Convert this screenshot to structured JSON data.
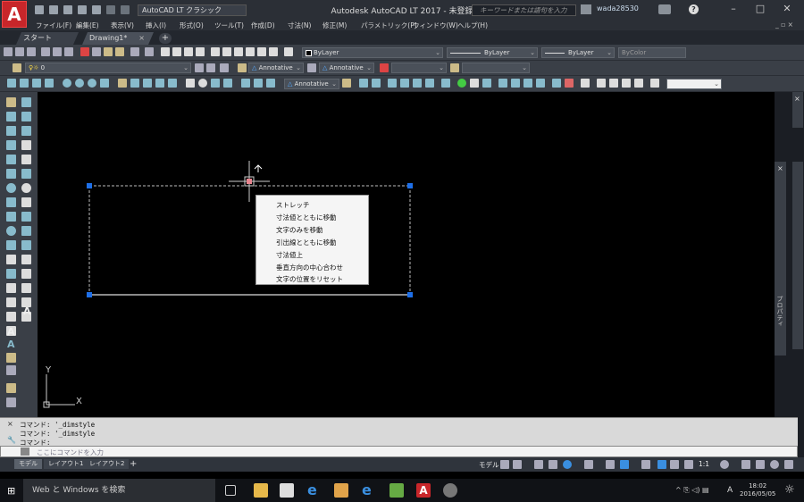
{
  "app": {
    "logo_letter": "A",
    "window_title": "Autodesk AutoCAD LT 2017 - 未登録",
    "workspace": "AutoCAD LT クラシック",
    "search_placeholder": "キーワードまたは語句を入力",
    "user": "wada28530"
  },
  "menubar": [
    "ファイル(F)",
    "編集(E)",
    "表示(V)",
    "挿入(I)",
    "形式(O)",
    "ツール(T)",
    "作成(D)",
    "寸法(N)",
    "修正(M)",
    "パラメトリック(P)",
    "ウィンドウ(W)",
    "ヘルプ(H)"
  ],
  "tabs": {
    "start": "スタート",
    "drawing": "Drawing1*"
  },
  "properties": {
    "color": "ByLayer",
    "linetype": "ByLayer",
    "lineweight": "ByLayer",
    "plotstyle": "ByColor"
  },
  "layer": {
    "current": "0"
  },
  "styles": {
    "text_style": "Annotative",
    "dim_style": "Annotative",
    "annotation_scale": "Annotative"
  },
  "context_menu": {
    "items": [
      "ストレッチ",
      "寸法値とともに移動",
      "文字のみを移動",
      "引出線とともに移動",
      "寸法値上",
      "垂直方向の中心合わせ",
      "文字の位置をリセット"
    ]
  },
  "command_history": [
    "コマンド: '_dimstyle",
    "コマンド: '_dimstyle",
    "コマンド:"
  ],
  "command_input_placeholder": "ここにコマンドを入力",
  "status": {
    "model_tab": "モデル",
    "layout1": "レイアウト1",
    "layout2": "レイアウト2",
    "model_label": "モデル",
    "scale": "1:1"
  },
  "ucs": {
    "x_label": "X",
    "y_label": "Y"
  },
  "taskbar": {
    "search": "Web と Windows を検索",
    "time": "18:02",
    "date": "2016/05/05",
    "ime": "A"
  },
  "right_panel": {
    "label": "プロパティ"
  },
  "colors": {
    "accent": "#c8262a",
    "grip": "#1e6fe8",
    "canvas": "#000000"
  }
}
